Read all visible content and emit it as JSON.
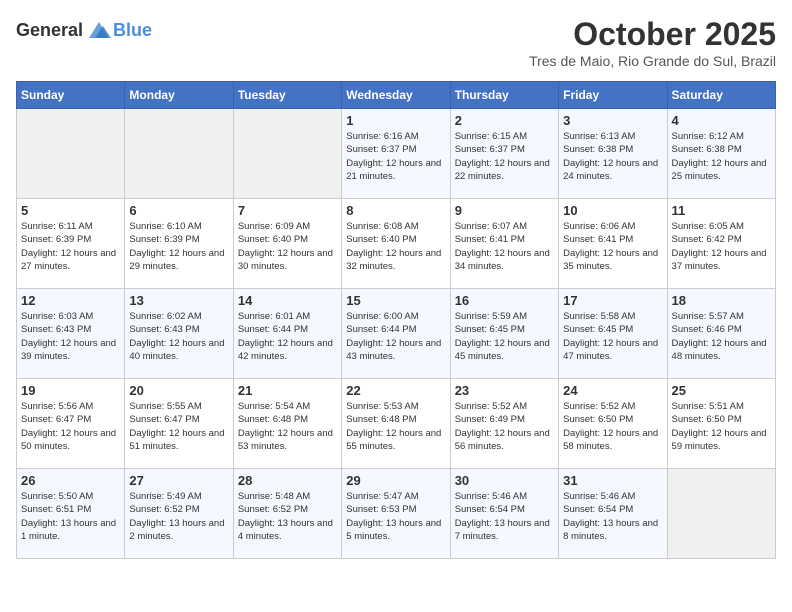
{
  "header": {
    "logo_general": "General",
    "logo_blue": "Blue",
    "month": "October 2025",
    "location": "Tres de Maio, Rio Grande do Sul, Brazil"
  },
  "days_of_week": [
    "Sunday",
    "Monday",
    "Tuesday",
    "Wednesday",
    "Thursday",
    "Friday",
    "Saturday"
  ],
  "weeks": [
    [
      {
        "day": "",
        "sunrise": "",
        "sunset": "",
        "daylight": "",
        "empty": true
      },
      {
        "day": "",
        "sunrise": "",
        "sunset": "",
        "daylight": "",
        "empty": true
      },
      {
        "day": "",
        "sunrise": "",
        "sunset": "",
        "daylight": "",
        "empty": true
      },
      {
        "day": "1",
        "sunrise": "Sunrise: 6:16 AM",
        "sunset": "Sunset: 6:37 PM",
        "daylight": "Daylight: 12 hours and 21 minutes.",
        "empty": false
      },
      {
        "day": "2",
        "sunrise": "Sunrise: 6:15 AM",
        "sunset": "Sunset: 6:37 PM",
        "daylight": "Daylight: 12 hours and 22 minutes.",
        "empty": false
      },
      {
        "day": "3",
        "sunrise": "Sunrise: 6:13 AM",
        "sunset": "Sunset: 6:38 PM",
        "daylight": "Daylight: 12 hours and 24 minutes.",
        "empty": false
      },
      {
        "day": "4",
        "sunrise": "Sunrise: 6:12 AM",
        "sunset": "Sunset: 6:38 PM",
        "daylight": "Daylight: 12 hours and 25 minutes.",
        "empty": false
      }
    ],
    [
      {
        "day": "5",
        "sunrise": "Sunrise: 6:11 AM",
        "sunset": "Sunset: 6:39 PM",
        "daylight": "Daylight: 12 hours and 27 minutes.",
        "empty": false
      },
      {
        "day": "6",
        "sunrise": "Sunrise: 6:10 AM",
        "sunset": "Sunset: 6:39 PM",
        "daylight": "Daylight: 12 hours and 29 minutes.",
        "empty": false
      },
      {
        "day": "7",
        "sunrise": "Sunrise: 6:09 AM",
        "sunset": "Sunset: 6:40 PM",
        "daylight": "Daylight: 12 hours and 30 minutes.",
        "empty": false
      },
      {
        "day": "8",
        "sunrise": "Sunrise: 6:08 AM",
        "sunset": "Sunset: 6:40 PM",
        "daylight": "Daylight: 12 hours and 32 minutes.",
        "empty": false
      },
      {
        "day": "9",
        "sunrise": "Sunrise: 6:07 AM",
        "sunset": "Sunset: 6:41 PM",
        "daylight": "Daylight: 12 hours and 34 minutes.",
        "empty": false
      },
      {
        "day": "10",
        "sunrise": "Sunrise: 6:06 AM",
        "sunset": "Sunset: 6:41 PM",
        "daylight": "Daylight: 12 hours and 35 minutes.",
        "empty": false
      },
      {
        "day": "11",
        "sunrise": "Sunrise: 6:05 AM",
        "sunset": "Sunset: 6:42 PM",
        "daylight": "Daylight: 12 hours and 37 minutes.",
        "empty": false
      }
    ],
    [
      {
        "day": "12",
        "sunrise": "Sunrise: 6:03 AM",
        "sunset": "Sunset: 6:43 PM",
        "daylight": "Daylight: 12 hours and 39 minutes.",
        "empty": false
      },
      {
        "day": "13",
        "sunrise": "Sunrise: 6:02 AM",
        "sunset": "Sunset: 6:43 PM",
        "daylight": "Daylight: 12 hours and 40 minutes.",
        "empty": false
      },
      {
        "day": "14",
        "sunrise": "Sunrise: 6:01 AM",
        "sunset": "Sunset: 6:44 PM",
        "daylight": "Daylight: 12 hours and 42 minutes.",
        "empty": false
      },
      {
        "day": "15",
        "sunrise": "Sunrise: 6:00 AM",
        "sunset": "Sunset: 6:44 PM",
        "daylight": "Daylight: 12 hours and 43 minutes.",
        "empty": false
      },
      {
        "day": "16",
        "sunrise": "Sunrise: 5:59 AM",
        "sunset": "Sunset: 6:45 PM",
        "daylight": "Daylight: 12 hours and 45 minutes.",
        "empty": false
      },
      {
        "day": "17",
        "sunrise": "Sunrise: 5:58 AM",
        "sunset": "Sunset: 6:45 PM",
        "daylight": "Daylight: 12 hours and 47 minutes.",
        "empty": false
      },
      {
        "day": "18",
        "sunrise": "Sunrise: 5:57 AM",
        "sunset": "Sunset: 6:46 PM",
        "daylight": "Daylight: 12 hours and 48 minutes.",
        "empty": false
      }
    ],
    [
      {
        "day": "19",
        "sunrise": "Sunrise: 5:56 AM",
        "sunset": "Sunset: 6:47 PM",
        "daylight": "Daylight: 12 hours and 50 minutes.",
        "empty": false
      },
      {
        "day": "20",
        "sunrise": "Sunrise: 5:55 AM",
        "sunset": "Sunset: 6:47 PM",
        "daylight": "Daylight: 12 hours and 51 minutes.",
        "empty": false
      },
      {
        "day": "21",
        "sunrise": "Sunrise: 5:54 AM",
        "sunset": "Sunset: 6:48 PM",
        "daylight": "Daylight: 12 hours and 53 minutes.",
        "empty": false
      },
      {
        "day": "22",
        "sunrise": "Sunrise: 5:53 AM",
        "sunset": "Sunset: 6:48 PM",
        "daylight": "Daylight: 12 hours and 55 minutes.",
        "empty": false
      },
      {
        "day": "23",
        "sunrise": "Sunrise: 5:52 AM",
        "sunset": "Sunset: 6:49 PM",
        "daylight": "Daylight: 12 hours and 56 minutes.",
        "empty": false
      },
      {
        "day": "24",
        "sunrise": "Sunrise: 5:52 AM",
        "sunset": "Sunset: 6:50 PM",
        "daylight": "Daylight: 12 hours and 58 minutes.",
        "empty": false
      },
      {
        "day": "25",
        "sunrise": "Sunrise: 5:51 AM",
        "sunset": "Sunset: 6:50 PM",
        "daylight": "Daylight: 12 hours and 59 minutes.",
        "empty": false
      }
    ],
    [
      {
        "day": "26",
        "sunrise": "Sunrise: 5:50 AM",
        "sunset": "Sunset: 6:51 PM",
        "daylight": "Daylight: 13 hours and 1 minute.",
        "empty": false
      },
      {
        "day": "27",
        "sunrise": "Sunrise: 5:49 AM",
        "sunset": "Sunset: 6:52 PM",
        "daylight": "Daylight: 13 hours and 2 minutes.",
        "empty": false
      },
      {
        "day": "28",
        "sunrise": "Sunrise: 5:48 AM",
        "sunset": "Sunset: 6:52 PM",
        "daylight": "Daylight: 13 hours and 4 minutes.",
        "empty": false
      },
      {
        "day": "29",
        "sunrise": "Sunrise: 5:47 AM",
        "sunset": "Sunset: 6:53 PM",
        "daylight": "Daylight: 13 hours and 5 minutes.",
        "empty": false
      },
      {
        "day": "30",
        "sunrise": "Sunrise: 5:46 AM",
        "sunset": "Sunset: 6:54 PM",
        "daylight": "Daylight: 13 hours and 7 minutes.",
        "empty": false
      },
      {
        "day": "31",
        "sunrise": "Sunrise: 5:46 AM",
        "sunset": "Sunset: 6:54 PM",
        "daylight": "Daylight: 13 hours and 8 minutes.",
        "empty": false
      },
      {
        "day": "",
        "sunrise": "",
        "sunset": "",
        "daylight": "",
        "empty": true
      }
    ]
  ]
}
